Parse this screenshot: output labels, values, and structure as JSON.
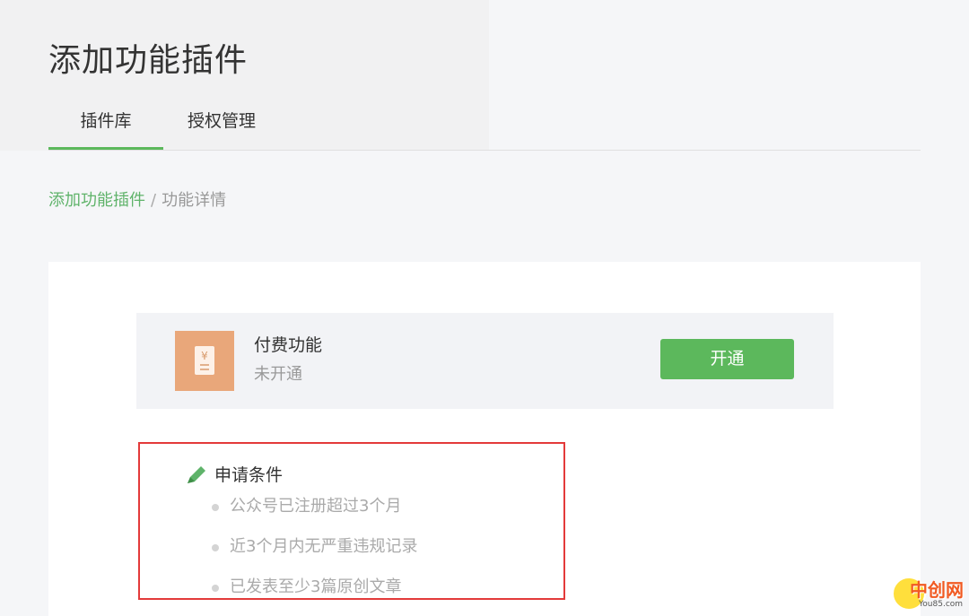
{
  "header": {
    "title": "添加功能插件",
    "tabs": [
      {
        "label": "插件库",
        "active": true
      },
      {
        "label": "授权管理",
        "active": false
      }
    ]
  },
  "breadcrumb": {
    "parent": "添加功能插件",
    "separator": "/",
    "current": "功能详情"
  },
  "feature": {
    "icon": "paid-document-icon",
    "icon_glyph": "¥",
    "name": "付费功能",
    "status": "未开通",
    "button_label": "开通"
  },
  "conditions": {
    "icon": "pen-icon",
    "title": "申请条件",
    "items": [
      "公众号已注册超过3个月",
      "近3个月内无严重违规记录",
      "已发表至少3篇原创文章"
    ]
  },
  "watermark": {
    "text": "中创网",
    "sub": "You85.com"
  },
  "colors": {
    "accent": "#5cb85c",
    "highlight_border": "#e33a3a",
    "feature_icon_bg": "#e9a77a"
  }
}
